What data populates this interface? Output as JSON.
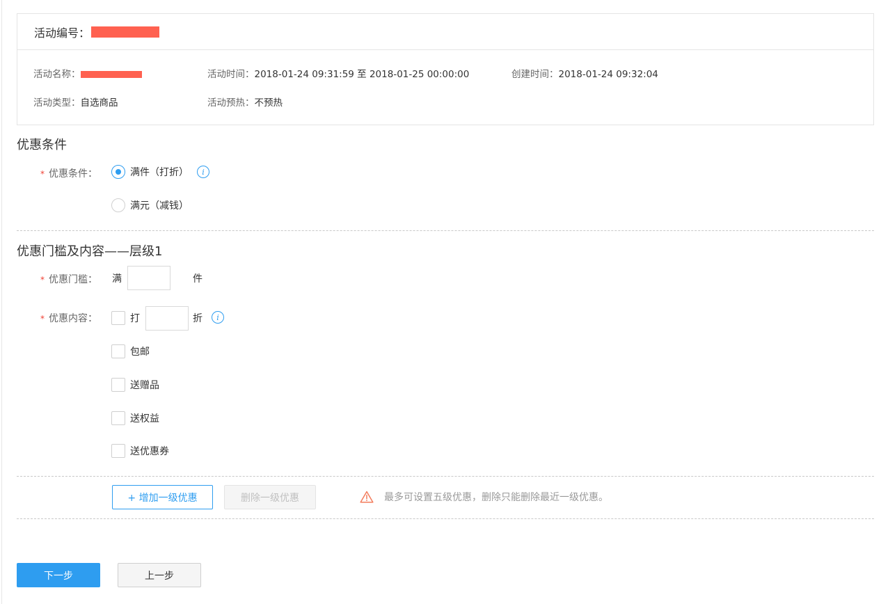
{
  "activity": {
    "id_label": "活动编号：",
    "name_label": "活动名称：",
    "time_label": "活动时间：",
    "time_value": "2018-01-24 09:31:59 至 2018-01-25 00:00:00",
    "created_label": "创建时间：",
    "created_value": "2018-01-24 09:32:04",
    "type_label": "活动类型：",
    "type_value": "自选商品",
    "preheat_label": "活动预热：",
    "preheat_value": "不预热"
  },
  "condition_section": {
    "title": "优惠条件",
    "label": "优惠条件：",
    "options": [
      {
        "label": "满件（打折）",
        "selected": true
      },
      {
        "label": "满元（减钱）",
        "selected": false
      }
    ]
  },
  "threshold_section": {
    "title": "优惠门槛及内容——层级1",
    "threshold_label": "优惠门槛：",
    "threshold_prefix": "满",
    "threshold_value": "",
    "threshold_suffix": "件",
    "content_label": "优惠内容：",
    "discount_prefix": "打",
    "discount_value": "",
    "discount_suffix": "折",
    "options": [
      {
        "label": "包邮",
        "checked": false
      },
      {
        "label": "送赠品",
        "checked": false
      },
      {
        "label": "送权益",
        "checked": false
      },
      {
        "label": "送优惠券",
        "checked": false
      }
    ]
  },
  "level_actions": {
    "add_label": "+ 增加一级优惠",
    "delete_label": "删除一级优惠",
    "warning": "最多可设置五级优惠，删除只能删除最近一级优惠。"
  },
  "footer": {
    "next_label": "下一步",
    "prev_label": "上一步"
  },
  "colors": {
    "accent": "#2e9df0",
    "required": "#f04134",
    "redaction": "#ff6150",
    "warning_icon": "#f37c5c"
  }
}
